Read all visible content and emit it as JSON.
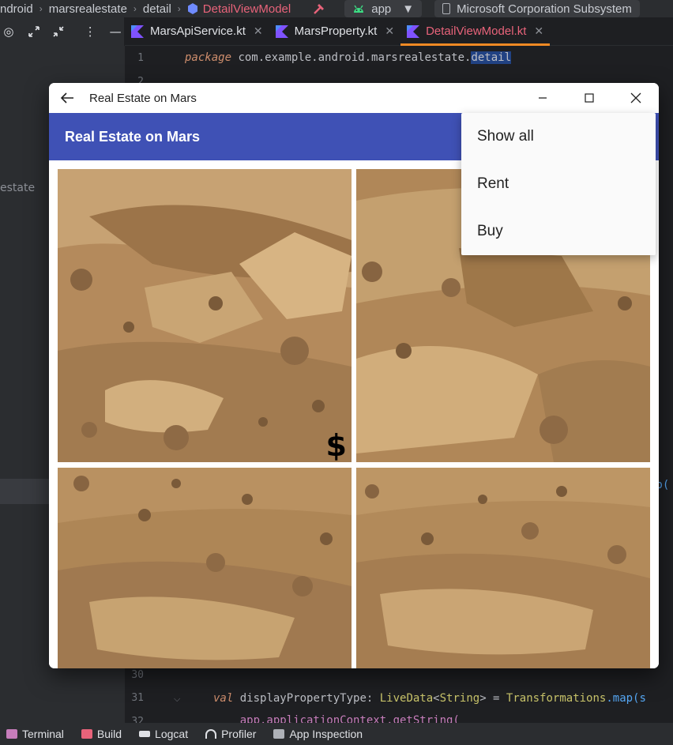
{
  "ide": {
    "breadcrumb": [
      "ndroid",
      "marsrealestate",
      "detail",
      "DetailViewModel"
    ],
    "run_config": "app",
    "device": "Microsoft Corporation Subsystem",
    "tabs": [
      {
        "label": "MarsApiService.kt",
        "active": false
      },
      {
        "label": "MarsProperty.kt",
        "active": false
      },
      {
        "label": "DetailViewModel.kt",
        "active": true
      }
    ],
    "project_panel_label": "estate",
    "line_numbers": {
      "first": "1",
      "second": "2",
      "l30": "30",
      "l31": "31",
      "l32": "32"
    },
    "code": {
      "line1_kw": "package",
      "line1_pkg": " com.example.android.marsrealestate.",
      "line1_sel": "detail",
      "line31_kw": "val",
      "line31_a": " displayPropertyType: ",
      "line31_type": "LiveData",
      "line31_b": "<",
      "line31_c": "String",
      "line31_d": "> = ",
      "line31_e": "Transformations",
      "line31_f": ".map(s",
      "line32": "    app.applicationContext.getString(",
      "right_edge": "ap("
    },
    "bottom_tools": [
      "Terminal",
      "Build",
      "Logcat",
      "Profiler",
      "App Inspection"
    ],
    "colors": {
      "accent_red": "#e8637a",
      "tab_underline": "#f08a24",
      "kotlin_purple": "#7f52ff"
    }
  },
  "emulator": {
    "window_title": "Real Estate on Mars",
    "app_bar_title": "Real Estate on Mars",
    "app_bar_color": "#3f51b5",
    "menu_items": [
      "Show all",
      "Rent",
      "Buy"
    ],
    "price_symbol": "$"
  }
}
